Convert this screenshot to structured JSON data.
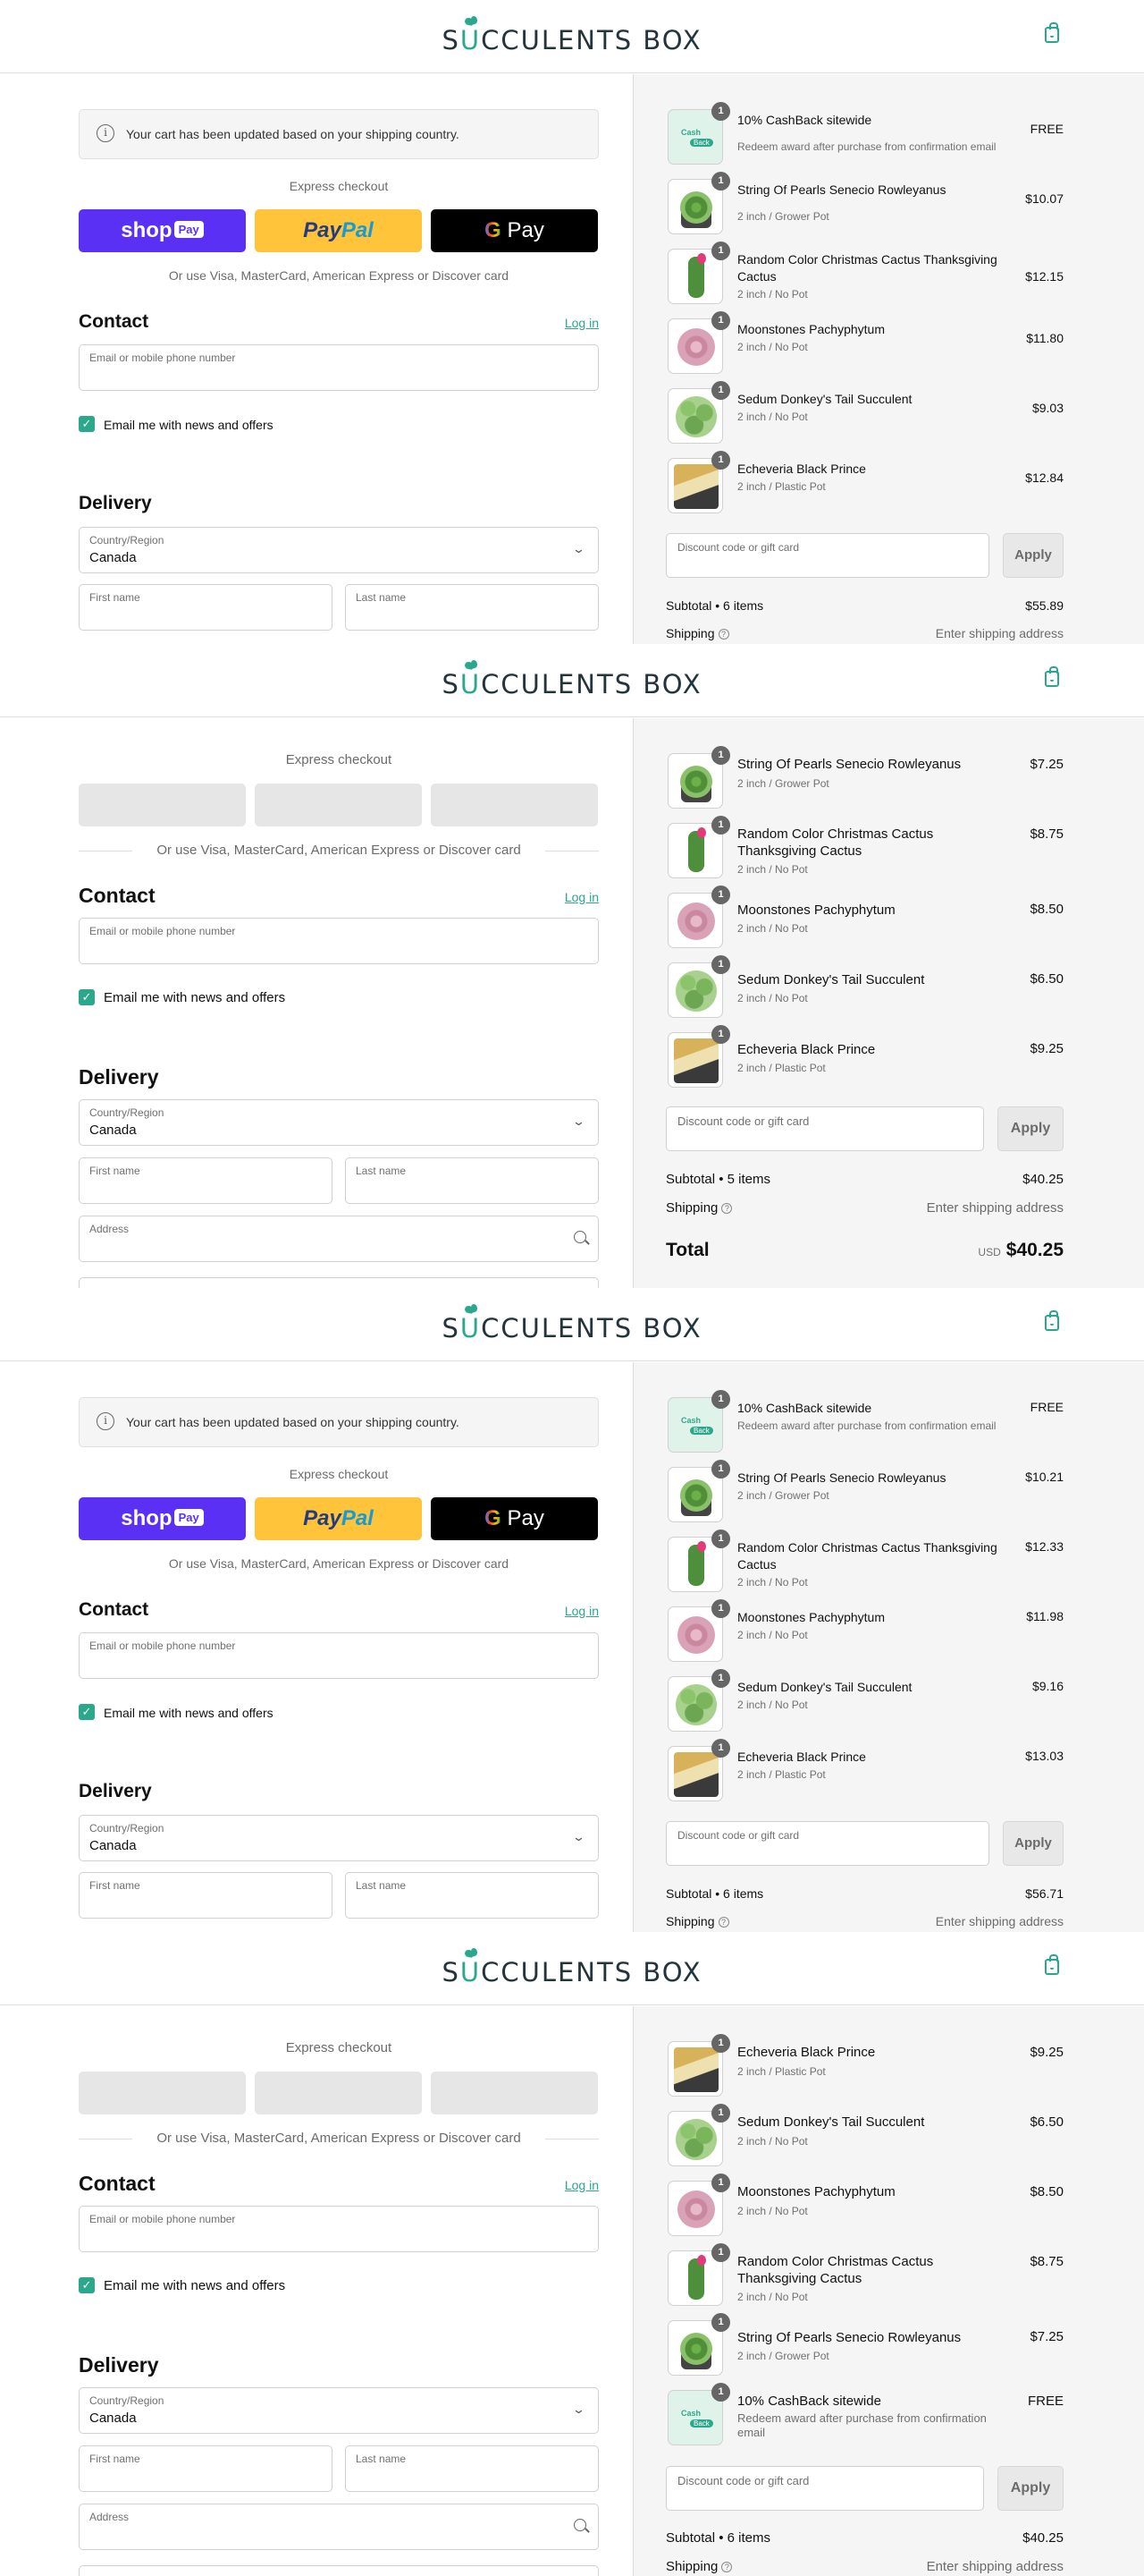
{
  "brand": {
    "logo_s": "S",
    "logo_u": "U",
    "logo_rest": "CCULENTS BOX",
    "accent": "#2ba88c"
  },
  "icons": {
    "cart": "shopping-bag-icon",
    "info": "info-circle-icon",
    "search": "search-icon",
    "chevron": "chevron-down-icon",
    "help": "question-circle-icon",
    "check": "checkmark-icon"
  },
  "checkout": {
    "notice": "Your cart has been updated based on your shipping country.",
    "express_label": "Express checkout",
    "shop_pay": "shop",
    "shop_pay_badge": "Pay",
    "paypal_a": "Pay",
    "paypal_b": "Pal",
    "gpay_g": "G",
    "gpay_pay": " Pay",
    "or_text": "Or use Visa, MasterCard, American Express or Discover card",
    "contact_title": "Contact",
    "login": "Log in",
    "email_placeholder": "Email or mobile phone number",
    "news_label": "Email me with news and offers",
    "check_glyph": "✓",
    "delivery_title": "Delivery",
    "country_label": "Country/Region",
    "country_value": "Canada",
    "first_name": "First name",
    "last_name": "Last name",
    "address": "Address",
    "chevron": "⌄",
    "info_glyph": "i"
  },
  "summary": {
    "discount_placeholder": "Discount code or gift card",
    "apply": "Apply",
    "shipping": "Shipping",
    "shipping_value": "Enter shipping address",
    "help_glyph": "?",
    "total_label": "Total",
    "currency": "USD",
    "badge_qty": "1",
    "cash_text": "Cash",
    "cash_tag": "Back"
  },
  "panels": [
    {
      "items": [
        {
          "name": "10% CashBack sitewide",
          "sub": "Redeem award after purchase from confirmation email",
          "price": "FREE"
        },
        {
          "name": "String Of Pearls Senecio Rowleyanus",
          "sub": "2 inch / Grower Pot",
          "price": "$10.07"
        },
        {
          "name": "Random Color Christmas Cactus Thanksgiving Cactus",
          "sub": "2 inch / No Pot",
          "price": "$12.15"
        },
        {
          "name": "Moonstones Pachyphytum",
          "sub": "2 inch / No Pot",
          "price": "$11.80"
        },
        {
          "name": "Sedum Donkey's Tail Succulent",
          "sub": "2 inch / No Pot",
          "price": "$9.03"
        },
        {
          "name": "Echeveria Black Prince",
          "sub": "2 inch / Plastic Pot",
          "price": "$12.84"
        }
      ],
      "subtotal_label": "Subtotal • 6 items",
      "subtotal": "$55.89"
    },
    {
      "items": [
        {
          "name": "String Of Pearls Senecio Rowleyanus",
          "sub": "2 inch / Grower Pot",
          "price": "$7.25"
        },
        {
          "name": "Random Color Christmas Cactus Thanksgiving Cactus",
          "sub": "2 inch / No Pot",
          "price": "$8.75"
        },
        {
          "name": "Moonstones Pachyphytum",
          "sub": "2 inch / No Pot",
          "price": "$8.50"
        },
        {
          "name": "Sedum Donkey's Tail Succulent",
          "sub": "2 inch / No Pot",
          "price": "$6.50"
        },
        {
          "name": "Echeveria Black Prince",
          "sub": "2 inch / Plastic Pot",
          "price": "$9.25"
        }
      ],
      "subtotal_label": "Subtotal • 5 items",
      "subtotal": "$40.25",
      "total": "$40.25"
    },
    {
      "items": [
        {
          "name": "10% CashBack sitewide",
          "sub": "Redeem award after purchase from confirmation email",
          "price": "FREE"
        },
        {
          "name": "String Of Pearls Senecio Rowleyanus",
          "sub": "2 inch / Grower Pot",
          "price": "$10.21"
        },
        {
          "name": "Random Color Christmas Cactus Thanksgiving Cactus",
          "sub": "2 inch / No Pot",
          "price": "$12.33"
        },
        {
          "name": "Moonstones Pachyphytum",
          "sub": "2 inch / No Pot",
          "price": "$11.98"
        },
        {
          "name": "Sedum Donkey's Tail Succulent",
          "sub": "2 inch / No Pot",
          "price": "$9.16"
        },
        {
          "name": "Echeveria Black Prince",
          "sub": "2 inch / Plastic Pot",
          "price": "$13.03"
        }
      ],
      "subtotal_label": "Subtotal • 6 items",
      "subtotal": "$56.71"
    },
    {
      "items": [
        {
          "name": "Echeveria Black Prince",
          "sub": "2 inch / Plastic Pot",
          "price": "$9.25"
        },
        {
          "name": "Sedum Donkey's Tail Succulent",
          "sub": "2 inch / No Pot",
          "price": "$6.50"
        },
        {
          "name": "Moonstones Pachyphytum",
          "sub": "2 inch / No Pot",
          "price": "$8.50"
        },
        {
          "name": "Random Color Christmas Cactus Thanksgiving Cactus",
          "sub": "2 inch / No Pot",
          "price": "$8.75"
        },
        {
          "name": "String Of Pearls Senecio Rowleyanus",
          "sub": "2 inch / Grower Pot",
          "price": "$7.25"
        },
        {
          "name": "10% CashBack sitewide",
          "sub": "Redeem award after purchase from confirmation email",
          "price": "FREE"
        }
      ],
      "subtotal_label": "Subtotal • 6 items",
      "subtotal": "$40.25"
    }
  ]
}
